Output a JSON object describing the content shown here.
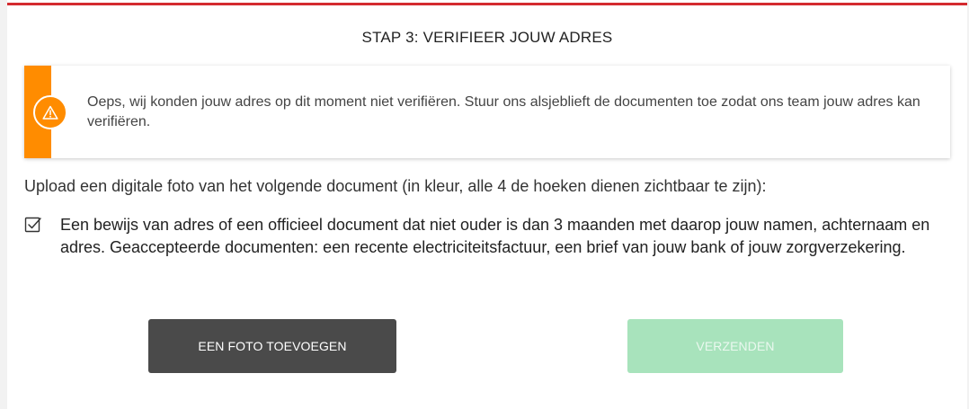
{
  "step": {
    "title": "STAP 3: VERIFIEER JOUW ADRES"
  },
  "alert": {
    "icon": "warning-icon",
    "message": "Oeps, wij konden jouw adres op dit moment niet verifiëren. Stuur ons alsjeblieft de documenten toe zodat ons team jouw adres kan verifiëren.",
    "accent_color": "#ff8c00"
  },
  "instruction": "Upload een digitale foto van het volgende document (in kleur, alle 4 de hoeken dienen zichtbaar te zijn):",
  "requirement": {
    "checked": true,
    "text": "Een bewijs van adres of een officieel document dat niet ouder is dan 3 maanden met daarop jouw namen, achternaam en adres. Geaccepteerde documenten: een recente electriciteitsfactuur, een brief van jouw bank of jouw zorgverzekering."
  },
  "buttons": {
    "add_photo": "EEN FOTO TOEVOEGEN",
    "submit": "VERZENDEN",
    "submit_disabled": true
  },
  "colors": {
    "top_bar": "#d42a2f",
    "primary_button": "#4a4a4a",
    "submit_button_disabled": "#a8e3bc"
  }
}
